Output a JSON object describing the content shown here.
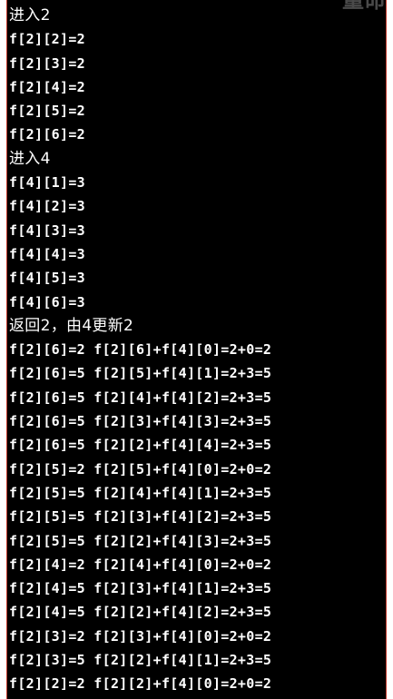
{
  "window": {
    "title_fragment": "量命"
  },
  "console": {
    "lines": [
      {
        "text": "进入2",
        "cjk": true
      },
      {
        "text": "f[2][2]=2",
        "cjk": false
      },
      {
        "text": "f[2][3]=2",
        "cjk": false
      },
      {
        "text": "f[2][4]=2",
        "cjk": false
      },
      {
        "text": "f[2][5]=2",
        "cjk": false
      },
      {
        "text": "f[2][6]=2",
        "cjk": false
      },
      {
        "text": "进入4",
        "cjk": true
      },
      {
        "text": "f[4][1]=3",
        "cjk": false
      },
      {
        "text": "f[4][2]=3",
        "cjk": false
      },
      {
        "text": "f[4][3]=3",
        "cjk": false
      },
      {
        "text": "f[4][4]=3",
        "cjk": false
      },
      {
        "text": "f[4][5]=3",
        "cjk": false
      },
      {
        "text": "f[4][6]=3",
        "cjk": false
      },
      {
        "text": "返回2，由4更新2",
        "cjk": true
      },
      {
        "text": "f[2][6]=2 f[2][6]+f[4][0]=2+0=2",
        "cjk": false
      },
      {
        "text": "f[2][6]=5 f[2][5]+f[4][1]=2+3=5",
        "cjk": false
      },
      {
        "text": "f[2][6]=5 f[2][4]+f[4][2]=2+3=5",
        "cjk": false
      },
      {
        "text": "f[2][6]=5 f[2][3]+f[4][3]=2+3=5",
        "cjk": false
      },
      {
        "text": "f[2][6]=5 f[2][2]+f[4][4]=2+3=5",
        "cjk": false
      },
      {
        "text": "f[2][5]=2 f[2][5]+f[4][0]=2+0=2",
        "cjk": false
      },
      {
        "text": "f[2][5]=5 f[2][4]+f[4][1]=2+3=5",
        "cjk": false
      },
      {
        "text": "f[2][5]=5 f[2][3]+f[4][2]=2+3=5",
        "cjk": false
      },
      {
        "text": "f[2][5]=5 f[2][2]+f[4][3]=2+3=5",
        "cjk": false
      },
      {
        "text": "f[2][4]=2 f[2][4]+f[4][0]=2+0=2",
        "cjk": false
      },
      {
        "text": "f[2][4]=5 f[2][3]+f[4][1]=2+3=5",
        "cjk": false
      },
      {
        "text": "f[2][4]=5 f[2][2]+f[4][2]=2+3=5",
        "cjk": false
      },
      {
        "text": "f[2][3]=2 f[2][3]+f[4][0]=2+0=2",
        "cjk": false
      },
      {
        "text": "f[2][3]=5 f[2][2]+f[4][1]=2+3=5",
        "cjk": false
      },
      {
        "text": "f[2][2]=2 f[2][2]+f[4][0]=2+0=2",
        "cjk": false
      }
    ]
  }
}
